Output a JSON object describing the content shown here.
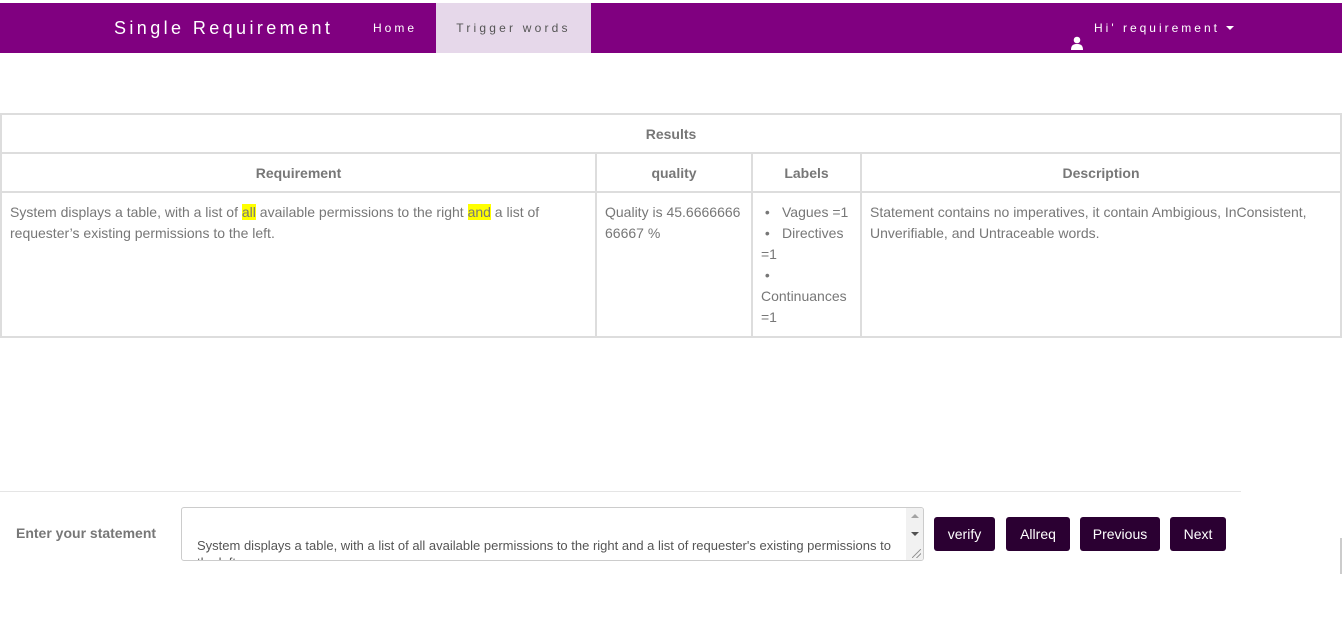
{
  "navbar": {
    "brand": "Single Requirement",
    "home_label": "Home",
    "trigger_label": "Trigger words",
    "user_label": "Hi' requirement",
    "color": "#800080",
    "active_tab_color": "#e6d8ea"
  },
  "results": {
    "title": "Results",
    "columns": [
      "Requirement",
      "quality",
      "Labels",
      "Description"
    ],
    "row": {
      "requirement_parts": [
        "System displays a table, with a list of ",
        "all",
        " available permissions to the right ",
        "and",
        " a list of requester’s existing permissions to the left."
      ],
      "quality": "Quality is 45.666666666667 %",
      "labels": [
        "Vagues =1",
        "Directives =1",
        "Continuances =1"
      ],
      "description": "Statement contains no imperatives, it contain Ambigious, InConsistent, Unverifiable, and Untraceable words."
    },
    "highlight_color": "#ffff00"
  },
  "input": {
    "label": "Enter your statement",
    "value": "System displays a table, with a list of all available permissions to the right and a list of requester's existing permissions to the left."
  },
  "buttons": {
    "verify": "verify",
    "allreq": "Allreq",
    "previous": "Previous",
    "next": "Next",
    "color": "#2b0032"
  },
  "icons": {
    "user": "user-icon",
    "caret": "chevron-down-icon"
  }
}
